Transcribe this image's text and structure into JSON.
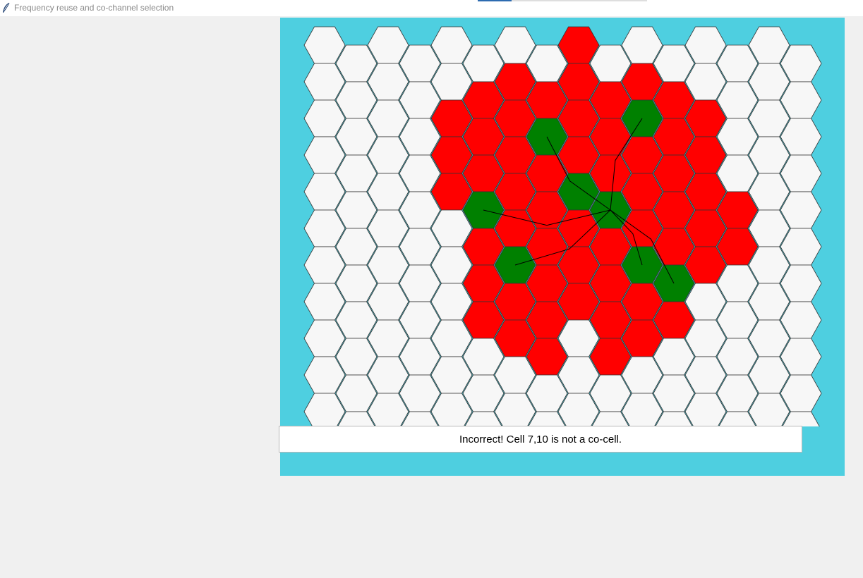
{
  "window": {
    "title": "Frequency reuse and co-channel selection",
    "progress_fraction": 0.2
  },
  "colors": {
    "panel": "#4ecfe0",
    "cell_default": "#f7f7f7",
    "cell_interferer": "#ff0000",
    "cell_cochannel": "#008000",
    "outline": "#333333",
    "link": "#000000"
  },
  "grid": {
    "columns": 16,
    "rows": 11,
    "red_cells": [
      [
        4,
        2
      ],
      [
        4,
        3
      ],
      [
        4,
        4
      ],
      [
        5,
        1
      ],
      [
        5,
        2
      ],
      [
        5,
        3
      ],
      [
        5,
        4
      ],
      [
        5,
        5
      ],
      [
        5,
        6
      ],
      [
        5,
        7
      ],
      [
        6,
        1
      ],
      [
        6,
        2
      ],
      [
        6,
        3
      ],
      [
        6,
        4
      ],
      [
        6,
        5
      ],
      [
        6,
        6
      ],
      [
        6,
        7
      ],
      [
        6,
        8
      ],
      [
        7,
        1
      ],
      [
        7,
        2
      ],
      [
        7,
        3
      ],
      [
        7,
        4
      ],
      [
        7,
        5
      ],
      [
        7,
        6
      ],
      [
        7,
        7
      ],
      [
        7,
        8
      ],
      [
        8,
        0
      ],
      [
        8,
        1
      ],
      [
        8,
        2
      ],
      [
        8,
        3
      ],
      [
        8,
        4
      ],
      [
        8,
        5
      ],
      [
        8,
        6
      ],
      [
        8,
        7
      ],
      [
        9,
        1
      ],
      [
        9,
        2
      ],
      [
        9,
        3
      ],
      [
        9,
        4
      ],
      [
        9,
        5
      ],
      [
        9,
        6
      ],
      [
        9,
        7
      ],
      [
        9,
        8
      ],
      [
        10,
        1
      ],
      [
        10,
        2
      ],
      [
        10,
        3
      ],
      [
        10,
        4
      ],
      [
        10,
        5
      ],
      [
        10,
        6
      ],
      [
        10,
        7
      ],
      [
        10,
        8
      ],
      [
        11,
        1
      ],
      [
        11,
        2
      ],
      [
        11,
        3
      ],
      [
        11,
        4
      ],
      [
        11,
        5
      ],
      [
        11,
        6
      ],
      [
        11,
        7
      ],
      [
        12,
        2
      ],
      [
        12,
        3
      ],
      [
        12,
        4
      ],
      [
        12,
        5
      ],
      [
        12,
        6
      ],
      [
        13,
        4
      ],
      [
        13,
        5
      ]
    ],
    "green_cells": [
      [
        7,
        2
      ],
      [
        9,
        4
      ],
      [
        11,
        6
      ],
      [
        10,
        6
      ],
      [
        5,
        4
      ],
      [
        6,
        6
      ],
      [
        8,
        4
      ],
      [
        10,
        2
      ]
    ],
    "links": [
      [
        [
          9,
          4
        ],
        [
          7,
          2
        ]
      ],
      [
        [
          9,
          4
        ],
        [
          10,
          2
        ]
      ],
      [
        [
          9,
          4
        ],
        [
          5,
          4
        ]
      ],
      [
        [
          9,
          4
        ],
        [
          11,
          6
        ]
      ],
      [
        [
          9,
          4
        ],
        [
          6,
          6
        ]
      ],
      [
        [
          9,
          4
        ],
        [
          10,
          6
        ]
      ]
    ]
  },
  "status": {
    "message": "Incorrect! Cell 7,10 is not a co-cell."
  }
}
